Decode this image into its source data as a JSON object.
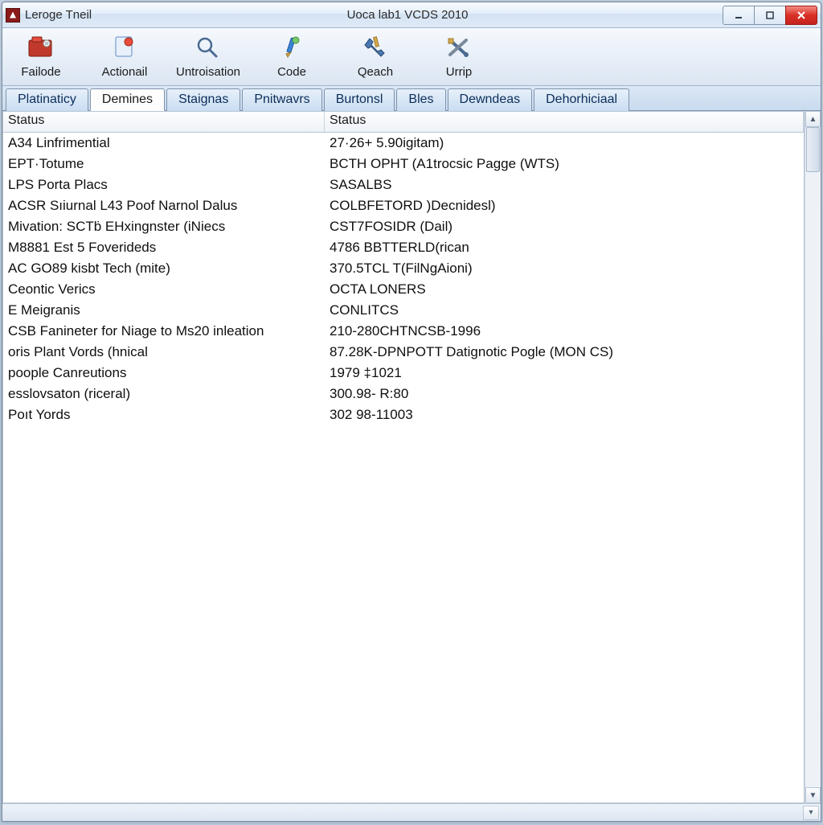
{
  "window": {
    "app_name": "Leroge Tneil",
    "title": "Uoca lab1 VCDS 2010"
  },
  "toolbar": [
    {
      "label": "Failode",
      "icon": "folder-red-icon"
    },
    {
      "label": "Actionail",
      "icon": "document-icon"
    },
    {
      "label": "Untroisation",
      "icon": "magnifier-icon"
    },
    {
      "label": "Code",
      "icon": "pencil-icon"
    },
    {
      "label": "Qeach",
      "icon": "wrench-icon"
    },
    {
      "label": "Urrip",
      "icon": "tools-cross-icon"
    }
  ],
  "tabs": [
    {
      "label": "Platinaticy",
      "active": false
    },
    {
      "label": "Demines",
      "active": true
    },
    {
      "label": "Staignas",
      "active": false
    },
    {
      "label": "Pnitwavrs",
      "active": false
    },
    {
      "label": "Burtonsl",
      "active": false
    },
    {
      "label": "Bles",
      "active": false
    },
    {
      "label": "Dewndeas",
      "active": false
    },
    {
      "label": "Dehorhiciaal",
      "active": false
    }
  ],
  "columns": [
    "Status",
    "Status"
  ],
  "rows": [
    {
      "c1": "A34 Linfrimential",
      "c2": "27·26+ 5.90igitam)"
    },
    {
      "c1": "EPT·Totume",
      "c2": "BCTH OPHT (A1trocsic Pagge (WTS)"
    },
    {
      "c1": "LPS Porta Placs",
      "c2": "SASALBS"
    },
    {
      "c1": "ACSR Sıiurnal L43 Poof Narnol Dalus",
      "c2": "COLBFETORD )Decnidesl)"
    },
    {
      "c1": "Mivation: SCTḃ EHxingnster (iNiecs",
      "c2": "CST7FOSIDR (Dail)"
    },
    {
      "c1": "M8881 Est 5 Foverideds",
      "c2": "4786 BBTTERLD(rican"
    },
    {
      "c1": "AC GO89 kisbt Tech (mite)",
      "c2": "370.5TCL T(FilNgAioni)"
    },
    {
      "c1": "Ceontic Verics",
      "c2": "OCTA LONERS"
    },
    {
      "c1": "E Meigranis",
      "c2": "CONLITCS"
    },
    {
      "c1": "CSB Fanineter for Niage to Ms20 inleation",
      "c2": "210-280CHTNCSB-1996"
    },
    {
      "c1": "oris Plant Vords (hnical",
      "c2": "87.28K-DPNPOTT Datignotic Pogle (MON CS)"
    },
    {
      "c1": "poople Canreutions",
      "c2": "1979 ‡1021"
    },
    {
      "c1": "esslovsaton (riceral)",
      "c2": "300.98- R:80"
    },
    {
      "c1": "Poıt Yords",
      "c2": "302 98-11003"
    }
  ]
}
